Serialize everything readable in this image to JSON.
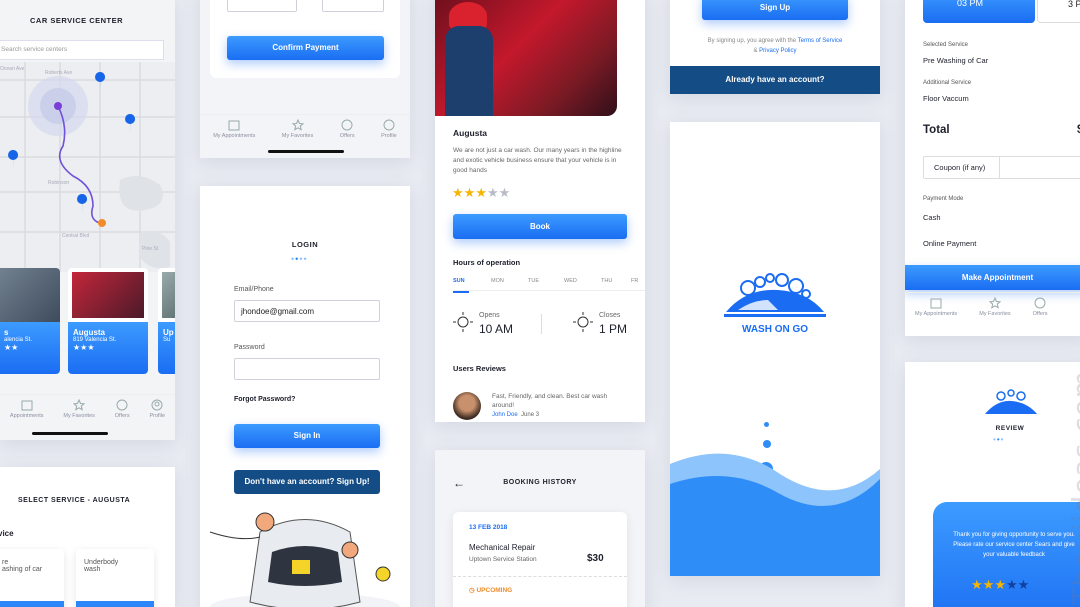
{
  "map_screen": {
    "title": "CAR SERVICE CENTER",
    "search_placeholder": "Search service centers",
    "streets": [
      "Roberts Ave",
      "Ocean Ave",
      "Oakland Ave",
      "Robinson",
      "Hopkins Blvd",
      "Walnut St",
      "Central Blvd",
      "Highland Ave",
      "Broadway Ave",
      "Spruce Ave",
      "Pine St"
    ],
    "cards": [
      {
        "name": "s",
        "address": "alencia St."
      },
      {
        "name": "Augusta",
        "address": "819 Valencia St."
      },
      {
        "name": "Up",
        "address": "Su"
      }
    ],
    "tabs": [
      "Appointments",
      "My Favorites",
      "Offers",
      "Profile"
    ]
  },
  "payment_screen": {
    "confirm_label": "Confirm Payment",
    "tabs": [
      "My Appointments",
      "My Favorites",
      "Offers",
      "Profile"
    ]
  },
  "login_screen": {
    "title": "LOGIN",
    "email_label": "Email/Phone",
    "email_value": "jhondoe@gmail.com",
    "password_label": "Password",
    "forgot": "Forgot Password?",
    "signin": "Sign In",
    "signup_prompt": "Don't have an account? Sign Up!"
  },
  "select_service_screen": {
    "title": "SELECT SERVICE - AUGUSTA",
    "section": "vice",
    "options": [
      {
        "line1": "re",
        "line2": "ashing of car"
      },
      {
        "line1": "Underbody",
        "line2": "wash"
      }
    ]
  },
  "detail_screen": {
    "name": "Augusta",
    "description": "We are not just a car wash. Our many years in the highline and exotic vehicle business ensure that your vehicle is in good hands",
    "rating": 3,
    "rating_max": 5,
    "book_label": "Book",
    "hours_title": "Hours of operation",
    "days": [
      "SUN",
      "MON",
      "TUE",
      "WED",
      "THU",
      "FR"
    ],
    "opens_label": "Opens",
    "opens_time": "10 AM",
    "closes_label": "Closes",
    "closes_time": "1 PM",
    "reviews_title": "Users Reviews",
    "review_text": "Fast, Friendly, and clean. Best car wash around!",
    "review_author": "John Doe",
    "review_date": "June 3"
  },
  "booking_screen": {
    "title": "BOOKING HISTORY",
    "date": "13 FEB 2018",
    "service": "Mechanical Repair",
    "station": "Uptown Service Station",
    "price": "$30",
    "status": "UPCOMING"
  },
  "signup_screen": {
    "signup_label": "Sign Up",
    "terms_prefix": "By signing up, you agree with the ",
    "terms_link": "Terms of Service",
    "terms_and": "& ",
    "privacy_link": "Privacy Policy",
    "login_prompt": "Already have an account?"
  },
  "splash_screen": {
    "logo_text": "WASH ON GO"
  },
  "appointment_screen": {
    "time1": "03 PM",
    "time2": "3 P",
    "selected_service_label": "Selected Service",
    "selected_service": "Pre Washing of Car",
    "additional_label": "Additional Service",
    "additional": "Floor Vaccum",
    "total_label": "Total",
    "total_value": "$",
    "coupon_label": "Coupon (if any)",
    "payment_mode_label": "Payment Mode",
    "payment_cash": "Cash",
    "payment_online": "Online Payment",
    "make_appointment": "Make Appointment",
    "tabs": [
      "My Appointments",
      "My Favorites",
      "Offers"
    ]
  },
  "review_screen": {
    "title": "REVIEW",
    "message": "Thank you for giving opportunity to serve you. Please rate our service center Sears and give your valuable feedback",
    "rating": 3,
    "rating_max": 5
  },
  "watermark": "Theuiideas.com",
  "colors": {
    "primary": "#1a6df2",
    "dark_blue": "#144c86",
    "star": "#f7b500",
    "wave": "#2f8df7"
  }
}
